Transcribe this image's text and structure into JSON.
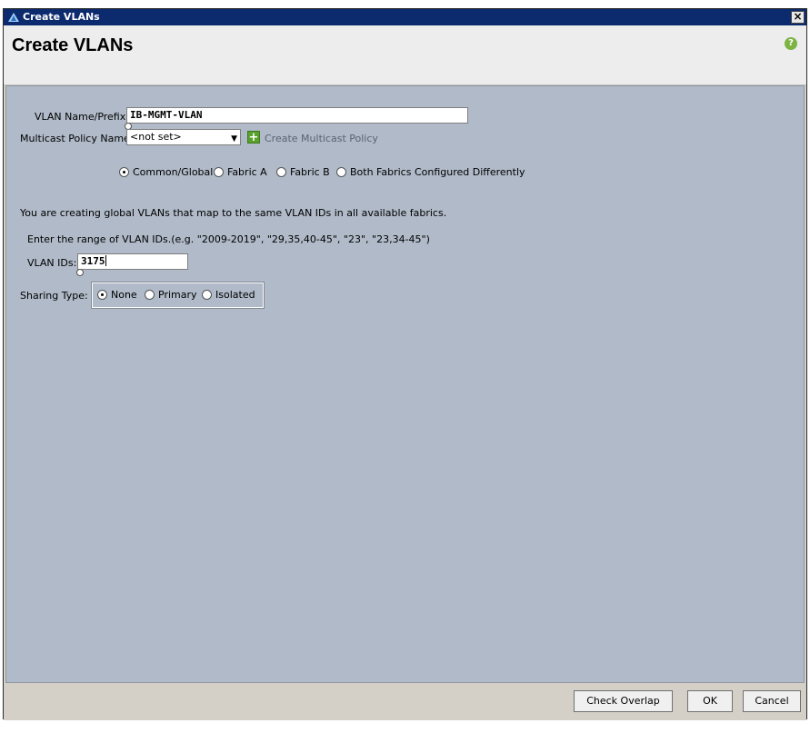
{
  "window": {
    "title": "Create VLANs",
    "close_glyph": "×"
  },
  "header": {
    "title": "Create VLANs",
    "help_glyph": "?"
  },
  "form": {
    "vlan_name_label": "VLAN Name/Prefix:",
    "vlan_name_value": "IB-MGMT-VLAN",
    "multicast_label": "Multicast Policy Name:",
    "multicast_selected": "<not set>",
    "create_multicast_link": "Create Multicast Policy",
    "fabric_options": [
      {
        "label": "Common/Global",
        "selected": true
      },
      {
        "label": "Fabric A",
        "selected": false
      },
      {
        "label": "Fabric B",
        "selected": false
      },
      {
        "label": "Both Fabrics Configured Differently",
        "selected": false
      }
    ],
    "info_text": "You are creating global VLANs that map to the same VLAN IDs in all available fabrics.",
    "range_hint": "Enter the range of VLAN IDs.(e.g. \"2009-2019\", \"29,35,40-45\", \"23\", \"23,34-45\")",
    "vlan_ids_label": "VLAN IDs:",
    "vlan_ids_value": "3175",
    "sharing_label": "Sharing Type:",
    "sharing_options": [
      {
        "label": "None",
        "selected": true
      },
      {
        "label": "Primary",
        "selected": false
      },
      {
        "label": "Isolated",
        "selected": false
      }
    ]
  },
  "footer": {
    "check_overlap": "Check Overlap",
    "ok": "OK",
    "cancel": "Cancel"
  },
  "colors": {
    "titlebar": "#0c2a6e",
    "content_bg": "#b0bac8",
    "help_green": "#7cb342"
  }
}
